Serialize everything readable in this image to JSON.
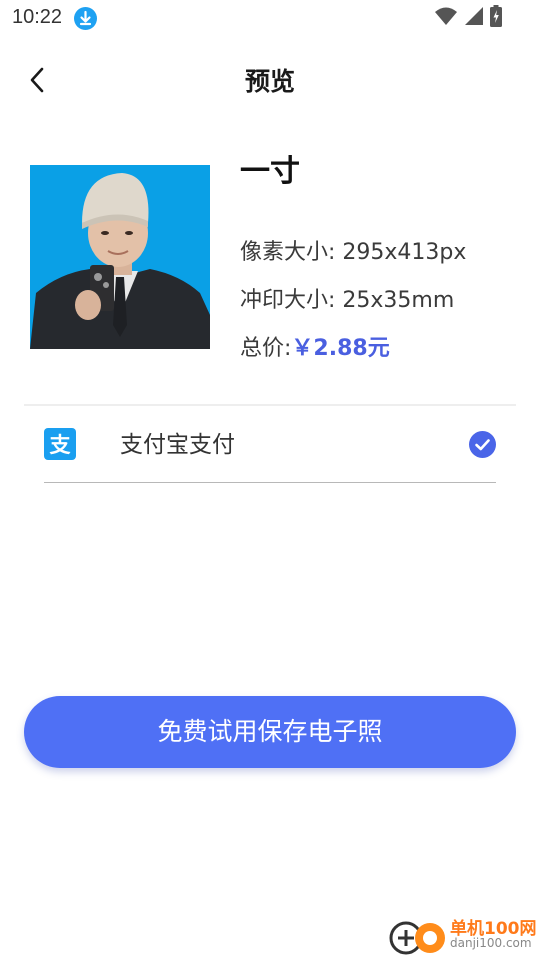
{
  "status_bar": {
    "time": "10:22",
    "icons": [
      "download-icon",
      "wifi-icon",
      "signal-icon",
      "battery-charging-icon"
    ]
  },
  "header": {
    "back_icon": "chevron-left-icon",
    "title": "预览"
  },
  "spec": {
    "name": "一寸",
    "pixel_label": "像素大小: ",
    "pixel_value": "295x413px",
    "print_label": "冲印大小: ",
    "print_value": "25x35mm",
    "price_label": "总价:",
    "price_value": "￥2.88元"
  },
  "payment": {
    "icon": "alipay-icon",
    "icon_glyph": "支",
    "label": "支付宝支付",
    "selected": true,
    "check_icon": "check-circle-icon"
  },
  "primary_button": {
    "label": "免费试用保存电子照"
  },
  "watermark": {
    "text": "单机100网",
    "url": "danji100.com"
  },
  "colors": {
    "accent": "#4f70f5",
    "price": "#4a5fe0",
    "alipay": "#1a9ff0",
    "photo_bg": "#0aa0e6"
  }
}
